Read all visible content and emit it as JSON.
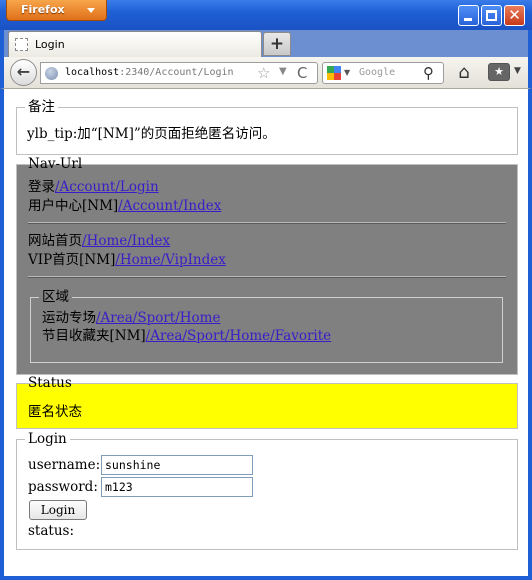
{
  "window": {
    "app_button": "Firefox",
    "minimize_glyph": "",
    "close_glyph": "✕"
  },
  "tabs": [
    {
      "label": "Login"
    }
  ],
  "new_tab_label": "+",
  "nav": {
    "back_glyph": "←",
    "url_host": "localhost",
    "url_path": ":2340/Account/Login",
    "star_glyph": "☆",
    "dropdown_glyph": "▼",
    "reload_glyph": "C",
    "search_placeholder": "Google",
    "search_glyph": "⚲",
    "home_glyph": "⌂",
    "bookmarks_glyph": "★",
    "bookmarks_drop_glyph": "▼"
  },
  "tip_box": {
    "legend": "备注",
    "text": "ylb_tip:加“[NM]”的页面拒绝匿名访问。"
  },
  "nav_url": {
    "legend": "Nav-Url",
    "links": [
      {
        "label": "登录",
        "href": "/Account/Login"
      },
      {
        "label": "用户中心[NM]",
        "href": "/Account/Index"
      },
      {
        "label": "网站首页",
        "href": "/Home/Index"
      },
      {
        "label": "VIP首页[NM]",
        "href": "/Home/VipIndex"
      }
    ],
    "area": {
      "legend": "区域",
      "links": [
        {
          "label": "运动专场",
          "href": "/Area/Sport/Home"
        },
        {
          "label": "节目收藏夹[NM]",
          "href": "/Area/Sport/Home/Favorite"
        }
      ]
    }
  },
  "status_box": {
    "legend": "Status",
    "text": "匿名状态"
  },
  "login": {
    "legend": "Login",
    "username_label": "username:",
    "username_value": "sunshine",
    "password_label": "password:",
    "password_value": "m123",
    "button_label": "Login",
    "status_label": "status:"
  },
  "colors": {
    "nav_background": "#808080",
    "status_background": "#ffff00",
    "link": "#3b1cc9",
    "titlebar": "#1f5fd6",
    "firefox_button": "#e0701a"
  }
}
